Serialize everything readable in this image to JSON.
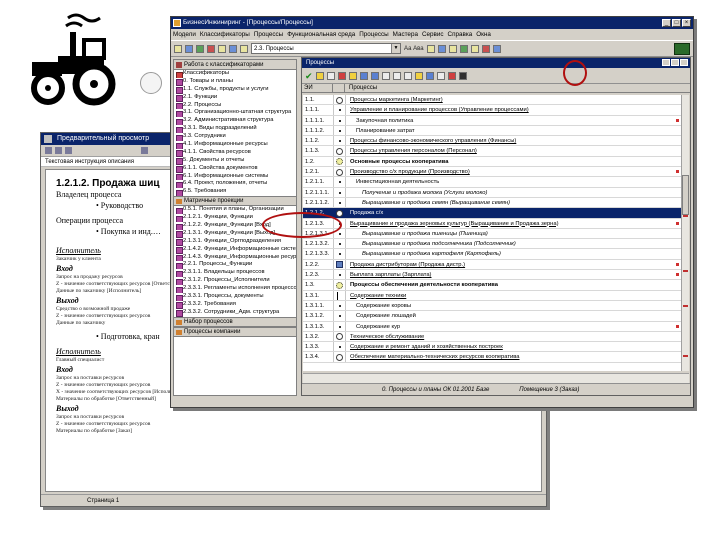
{
  "colors": {
    "titlebar": "#0a246a",
    "highlight_ring": "#b01010",
    "selection": "#0a246a"
  },
  "back_window": {
    "title": "Предварительный просмотр",
    "subtitle": "Текстовая инструкция описания",
    "heading": "1.2.1.2. Продажа шиц",
    "section_label_1": "Владелец процесса",
    "owner": "• Руководство",
    "section_label_2": "Операции процесса",
    "operation": "• Покупка и инд.…",
    "exec_label_1": "Исполнитель",
    "exec_text_1": "Заказчик у клиента",
    "input_label_1": "Вход",
    "input_lines_1": [
      "Запрос на продажу ресурсов",
      "Z - значение соответствующих ресурсов [Ответственный]",
      "Данные по заказчику [Исполнитель]"
    ],
    "output_label_1": "Выход",
    "output_lines_1": [
      "Средство о возможной продаже",
      "Z - значение соответствующих ресурсов",
      "Данные по заказчику"
    ],
    "mid_bullet": "• Подготовка, кран",
    "exec_label_2": "Исполнитель",
    "exec_text_2": "Главный специалист",
    "input_label_2": "Вход",
    "input_lines_2": [
      "Запрос на поставки ресурсов",
      "Z - значение соответствующих ресурсов",
      "X - значение соответствующих ресурсов [Исполнитель]",
      "Материалы по обработке [Ответственный]"
    ],
    "output_label_2": "Выход",
    "output_lines_2": [
      "Запрос на поставки ресурсов",
      "Z - значение соответствующих ресурсов",
      "Материалы по обработке [Заказ]"
    ],
    "status": "Страница 1"
  },
  "main_window": {
    "title": "БизнесИнжиниринг - [Процессы/Процессы]",
    "menu": [
      "Модели",
      "Классификаторы",
      "Процессы",
      "Функциональная среда",
      "Процессы",
      "Мастера",
      "Сервис",
      "Справка",
      "Окна"
    ],
    "combo_value": "2.3. Процессы",
    "toolbar_text": "Аа  Ава"
  },
  "left_panel": {
    "header": "Работа с классификаторами",
    "section_1": "Классификаторы",
    "items_1": [
      "0. Товары и планы",
      "1.1. Службы, продукты и услуги",
      "2.1. Функции",
      "2.2. Процессы",
      "3.1. Организационно-штатная структура",
      "3.2. Административная структура",
      "3.3.1. Виды подразделений",
      "3.3. Сотрудники",
      "4.1. Информационные ресурсы",
      "4.1.1. Свойства ресурсов",
      "5. Документы и отчеты",
      "6.1.1. Свойства документов",
      "6.1. Информационные системы",
      "6.4. Проект, положения, отчеты",
      "6.5. Требования"
    ],
    "section_2": "Матричные проекции",
    "items_2": [
      "0.5.1. Понятия и планы, Организации",
      "2.1.2.1. Функции, Функции",
      "2.1.2.2. Функции_Функции [Вход]",
      "2.1.3.1. Функции_Функции [Выход]",
      "2.1.3.1. Функции_Оргподразделения",
      "2.1.4.2. Функции_Информационные системы",
      "2.1.4.3. Функции_Информационные ресурсы",
      "2.2.1. Процессы_Функции",
      "2.3.1.1. Владельцы процессов",
      "2.3.1.2. Процессы_Исполнители",
      "2.3.3.1. Регламенты исполнения процессов",
      "2.3.3.1. Процессы, документы",
      "2.3.3.2. Требования",
      "2.3.3.2. Сотрудники_Адм. структура"
    ],
    "section_3": "Набор процессов",
    "section_4": "Процессы компании"
  },
  "process_window": {
    "title": "Процессы",
    "col_num": "ЭИ",
    "col_name": "Процессы",
    "rows": [
      {
        "num": "1.1.",
        "name": "Процессы маркетинга (Маркетинг)",
        "style": "u",
        "icon": "circle",
        "indent": 0
      },
      {
        "num": "1.1.1.",
        "name": "Управление и планирование процессов (Управление процессами)",
        "style": "u",
        "icon": "dot",
        "indent": 0
      },
      {
        "num": "1.1.1.1.",
        "name": "Закупочная политика",
        "style": "",
        "icon": "dot",
        "indent": 1
      },
      {
        "num": "1.1.1.2.",
        "name": "Планирование затрат",
        "style": "",
        "icon": "dot",
        "indent": 1
      },
      {
        "num": "1.1.2.",
        "name": "Процессы финансово-экономического управления (Финансы)",
        "style": "u",
        "icon": "dot",
        "indent": 0
      },
      {
        "num": "1.1.3.",
        "name": "Процессы управления персоналом (Персонал)",
        "style": "u",
        "icon": "circle",
        "indent": 0
      },
      {
        "num": "1.2.",
        "name": "Основные процессы кооператива",
        "style": "b",
        "icon": "gear",
        "indent": 0
      },
      {
        "num": "1.2.1.",
        "name": "Производство с/х продукции (Производство)",
        "style": "u",
        "icon": "circle",
        "indent": 0
      },
      {
        "num": "1.2.1.1.",
        "name": "Инвестиционная деятельность",
        "style": "",
        "icon": "dot",
        "indent": 1
      },
      {
        "num": "1.2.1.1.1.",
        "name": "Получение и продажа молока (Услуги молоко)",
        "style": "i",
        "icon": "dot",
        "indent": 2
      },
      {
        "num": "1.2.1.1.2.",
        "name": "Выращивание и продажа семян (Выращивание семян)",
        "style": "i",
        "icon": "dot",
        "indent": 2
      },
      {
        "num": "1.2.1.2.",
        "name": "Продажа с/х",
        "style": "sel",
        "icon": "circle",
        "indent": 0
      },
      {
        "num": "1.2.1.3.",
        "name": "Выращивание и продажа зерновых культур (Выращивание и Продажа зерна)",
        "style": "u",
        "icon": "dot",
        "indent": 0
      },
      {
        "num": "1.2.1.3.1.",
        "name": "Выращивание и продажа пшеницы (Пшеница)",
        "style": "i",
        "icon": "dot",
        "indent": 2
      },
      {
        "num": "1.2.1.3.2.",
        "name": "Выращивание и продажа подсолнечника (Подсолнечник)",
        "style": "i",
        "icon": "dot",
        "indent": 2
      },
      {
        "num": "1.2.1.3.3.",
        "name": "Выращивание и продажа картофеля (Картофель)",
        "style": "i",
        "icon": "dot",
        "indent": 2
      },
      {
        "num": "1.2.2.",
        "name": "Продажа дистрибуторам (Продажа дистр.)",
        "style": "u",
        "icon": "net",
        "indent": 0
      },
      {
        "num": "1.2.3.",
        "name": "Выплата зарплаты (Зарплата)",
        "style": "u",
        "icon": "dot",
        "indent": 0
      },
      {
        "num": "1.3.",
        "name": "Процессы обеспечения деятельности кооператива",
        "style": "b",
        "icon": "gear",
        "indent": 0
      },
      {
        "num": "1.3.1.",
        "name": "Содержание техники",
        "style": "u",
        "icon": "flag",
        "indent": 0
      },
      {
        "num": "1.3.1.1.",
        "name": "Содержание коровы",
        "style": "",
        "icon": "dot",
        "indent": 1
      },
      {
        "num": "1.3.1.2.",
        "name": "Содержание лошадей",
        "style": "",
        "icon": "dot",
        "indent": 1
      },
      {
        "num": "1.3.1.3.",
        "name": "Содержание кур",
        "style": "",
        "icon": "dot",
        "indent": 1
      },
      {
        "num": "1.3.2.",
        "name": "Техническое обслуживание",
        "style": "u",
        "icon": "circle",
        "indent": 0
      },
      {
        "num": "1.3.3.",
        "name": "Содержание и ремонт зданий и хозяйственных построек",
        "style": "u",
        "icon": "dot",
        "indent": 0
      },
      {
        "num": "1.3.4.",
        "name": "Обеспечение материально-технических ресурсов кооператива",
        "style": "u",
        "icon": "circle",
        "indent": 0
      }
    ],
    "status_left": "0. Процессы и планы ОК 01.2001 Базе",
    "status_right": "Помещение 3 (Заказ)"
  }
}
